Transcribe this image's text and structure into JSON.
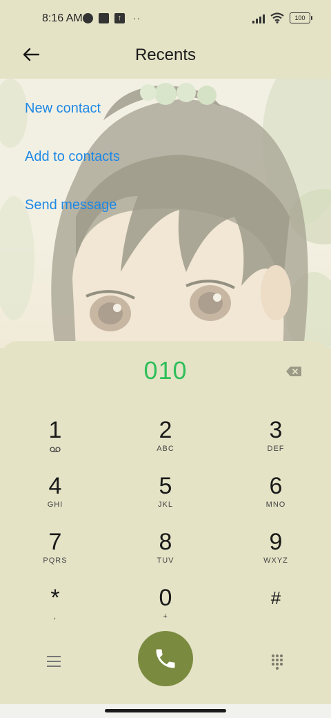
{
  "status_bar": {
    "time": "8:16 AM",
    "battery": "100"
  },
  "header": {
    "title": "Recents"
  },
  "menu": {
    "items": [
      {
        "label": "New contact"
      },
      {
        "label": "Add to contacts"
      },
      {
        "label": "Send message"
      }
    ]
  },
  "dialer": {
    "number": "010",
    "keys": [
      {
        "digit": "1",
        "letters": ""
      },
      {
        "digit": "2",
        "letters": "ABC"
      },
      {
        "digit": "3",
        "letters": "DEF"
      },
      {
        "digit": "4",
        "letters": "GHI"
      },
      {
        "digit": "5",
        "letters": "JKL"
      },
      {
        "digit": "6",
        "letters": "MNO"
      },
      {
        "digit": "7",
        "letters": "PQRS"
      },
      {
        "digit": "8",
        "letters": "TUV"
      },
      {
        "digit": "9",
        "letters": "WXYZ"
      },
      {
        "digit": "*",
        "letters": ","
      },
      {
        "digit": "0",
        "letters": "+"
      },
      {
        "digit": "#",
        "letters": ""
      }
    ]
  },
  "colors": {
    "accent_link": "#1e88e5",
    "number": "#2fbf5a",
    "call_button": "#7a8a3f",
    "panel": "#e4e3c6"
  },
  "icons": {
    "back": "back-arrow-icon",
    "backspace": "backspace-icon",
    "voicemail": "voicemail-icon",
    "menu": "menu-icon",
    "call": "phone-icon",
    "keypad": "keypad-icon"
  }
}
